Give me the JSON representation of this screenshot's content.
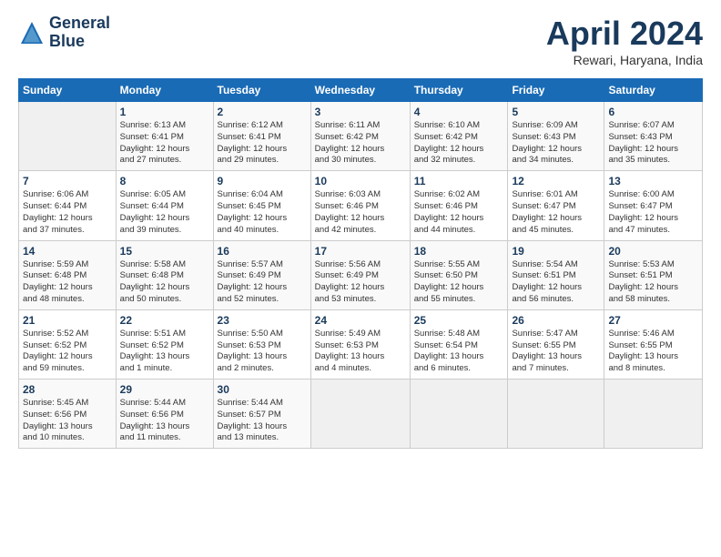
{
  "logo": {
    "line1": "General",
    "line2": "Blue"
  },
  "title": "April 2024",
  "location": "Rewari, Haryana, India",
  "header_days": [
    "Sunday",
    "Monday",
    "Tuesday",
    "Wednesday",
    "Thursday",
    "Friday",
    "Saturday"
  ],
  "weeks": [
    [
      {
        "num": "",
        "info": ""
      },
      {
        "num": "1",
        "info": "Sunrise: 6:13 AM\nSunset: 6:41 PM\nDaylight: 12 hours\nand 27 minutes."
      },
      {
        "num": "2",
        "info": "Sunrise: 6:12 AM\nSunset: 6:41 PM\nDaylight: 12 hours\nand 29 minutes."
      },
      {
        "num": "3",
        "info": "Sunrise: 6:11 AM\nSunset: 6:42 PM\nDaylight: 12 hours\nand 30 minutes."
      },
      {
        "num": "4",
        "info": "Sunrise: 6:10 AM\nSunset: 6:42 PM\nDaylight: 12 hours\nand 32 minutes."
      },
      {
        "num": "5",
        "info": "Sunrise: 6:09 AM\nSunset: 6:43 PM\nDaylight: 12 hours\nand 34 minutes."
      },
      {
        "num": "6",
        "info": "Sunrise: 6:07 AM\nSunset: 6:43 PM\nDaylight: 12 hours\nand 35 minutes."
      }
    ],
    [
      {
        "num": "7",
        "info": "Sunrise: 6:06 AM\nSunset: 6:44 PM\nDaylight: 12 hours\nand 37 minutes."
      },
      {
        "num": "8",
        "info": "Sunrise: 6:05 AM\nSunset: 6:44 PM\nDaylight: 12 hours\nand 39 minutes."
      },
      {
        "num": "9",
        "info": "Sunrise: 6:04 AM\nSunset: 6:45 PM\nDaylight: 12 hours\nand 40 minutes."
      },
      {
        "num": "10",
        "info": "Sunrise: 6:03 AM\nSunset: 6:46 PM\nDaylight: 12 hours\nand 42 minutes."
      },
      {
        "num": "11",
        "info": "Sunrise: 6:02 AM\nSunset: 6:46 PM\nDaylight: 12 hours\nand 44 minutes."
      },
      {
        "num": "12",
        "info": "Sunrise: 6:01 AM\nSunset: 6:47 PM\nDaylight: 12 hours\nand 45 minutes."
      },
      {
        "num": "13",
        "info": "Sunrise: 6:00 AM\nSunset: 6:47 PM\nDaylight: 12 hours\nand 47 minutes."
      }
    ],
    [
      {
        "num": "14",
        "info": "Sunrise: 5:59 AM\nSunset: 6:48 PM\nDaylight: 12 hours\nand 48 minutes."
      },
      {
        "num": "15",
        "info": "Sunrise: 5:58 AM\nSunset: 6:48 PM\nDaylight: 12 hours\nand 50 minutes."
      },
      {
        "num": "16",
        "info": "Sunrise: 5:57 AM\nSunset: 6:49 PM\nDaylight: 12 hours\nand 52 minutes."
      },
      {
        "num": "17",
        "info": "Sunrise: 5:56 AM\nSunset: 6:49 PM\nDaylight: 12 hours\nand 53 minutes."
      },
      {
        "num": "18",
        "info": "Sunrise: 5:55 AM\nSunset: 6:50 PM\nDaylight: 12 hours\nand 55 minutes."
      },
      {
        "num": "19",
        "info": "Sunrise: 5:54 AM\nSunset: 6:51 PM\nDaylight: 12 hours\nand 56 minutes."
      },
      {
        "num": "20",
        "info": "Sunrise: 5:53 AM\nSunset: 6:51 PM\nDaylight: 12 hours\nand 58 minutes."
      }
    ],
    [
      {
        "num": "21",
        "info": "Sunrise: 5:52 AM\nSunset: 6:52 PM\nDaylight: 12 hours\nand 59 minutes."
      },
      {
        "num": "22",
        "info": "Sunrise: 5:51 AM\nSunset: 6:52 PM\nDaylight: 13 hours\nand 1 minute."
      },
      {
        "num": "23",
        "info": "Sunrise: 5:50 AM\nSunset: 6:53 PM\nDaylight: 13 hours\nand 2 minutes."
      },
      {
        "num": "24",
        "info": "Sunrise: 5:49 AM\nSunset: 6:53 PM\nDaylight: 13 hours\nand 4 minutes."
      },
      {
        "num": "25",
        "info": "Sunrise: 5:48 AM\nSunset: 6:54 PM\nDaylight: 13 hours\nand 6 minutes."
      },
      {
        "num": "26",
        "info": "Sunrise: 5:47 AM\nSunset: 6:55 PM\nDaylight: 13 hours\nand 7 minutes."
      },
      {
        "num": "27",
        "info": "Sunrise: 5:46 AM\nSunset: 6:55 PM\nDaylight: 13 hours\nand 8 minutes."
      }
    ],
    [
      {
        "num": "28",
        "info": "Sunrise: 5:45 AM\nSunset: 6:56 PM\nDaylight: 13 hours\nand 10 minutes."
      },
      {
        "num": "29",
        "info": "Sunrise: 5:44 AM\nSunset: 6:56 PM\nDaylight: 13 hours\nand 11 minutes."
      },
      {
        "num": "30",
        "info": "Sunrise: 5:44 AM\nSunset: 6:57 PM\nDaylight: 13 hours\nand 13 minutes."
      },
      {
        "num": "",
        "info": ""
      },
      {
        "num": "",
        "info": ""
      },
      {
        "num": "",
        "info": ""
      },
      {
        "num": "",
        "info": ""
      }
    ]
  ]
}
